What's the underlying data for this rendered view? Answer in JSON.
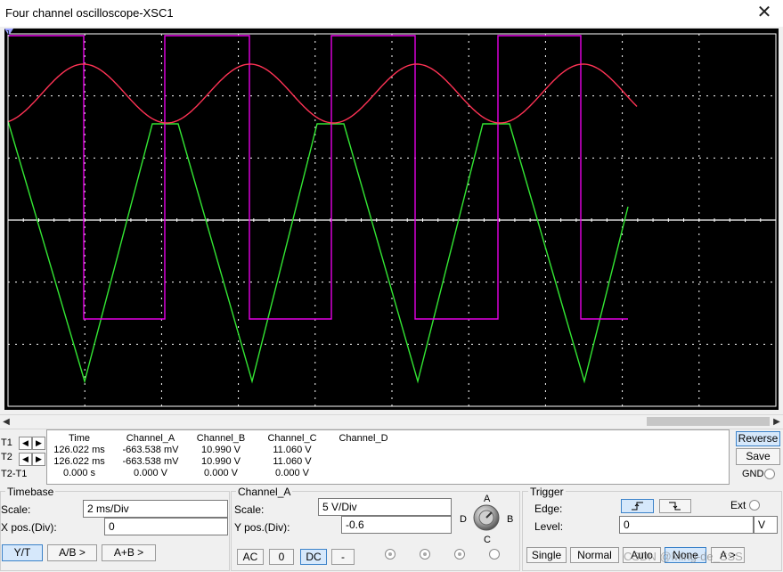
{
  "window": {
    "title": "Four channel oscilloscope-XSC1",
    "close_glyph": "✕"
  },
  "screen": {
    "background": "#000000",
    "grid_color": "#ffffff",
    "axis_color": "#ffffff",
    "channel_a_color": "#ff3355",
    "channel_b_color": "#33e633",
    "channel_c_color": "#e600e6",
    "cursor_color": "#ffffff",
    "cursor_t1_label": "1",
    "cursor_t2_label": "2"
  },
  "readout": {
    "row_labels": [
      "T1",
      "T2",
      "T2-T1"
    ],
    "headers": [
      "Time",
      "Channel_A",
      "Channel_B",
      "Channel_C",
      "Channel_D"
    ],
    "rows": [
      [
        "126.022 ms",
        "-663.538 mV",
        "10.990 V",
        "11.060 V",
        ""
      ],
      [
        "126.022 ms",
        "-663.538 mV",
        "10.990 V",
        "11.060 V",
        ""
      ],
      [
        "0.000 s",
        "0.000 V",
        "0.000 V",
        "0.000 V",
        ""
      ]
    ],
    "arrow_left": "◀",
    "arrow_right": "▶"
  },
  "side_buttons": {
    "reverse": "Reverse",
    "save": "Save",
    "gnd": "GND"
  },
  "timebase": {
    "title": "Timebase",
    "scale_label": "Scale:",
    "scale_value": "2 ms/Div",
    "xpos_label": "X pos.(Div):",
    "xpos_value": "0",
    "modes": [
      "Y/T",
      "A/B >",
      "A+B >"
    ]
  },
  "channel": {
    "title": "Channel_A",
    "scale_label": "Scale:",
    "scale_value": "5  V/Div",
    "ypos_label": "Y pos.(Div):",
    "ypos_value": "-0.6",
    "coupling": [
      "AC",
      "0",
      "DC",
      "-"
    ],
    "knob_labels": {
      "a": "A",
      "b": "B",
      "c": "C",
      "d": "D"
    }
  },
  "trigger": {
    "title": "Trigger",
    "edge_label": "Edge:",
    "ext_label": "Ext",
    "level_label": "Level:",
    "level_value": "0",
    "level_unit": "V",
    "modes": [
      "Single",
      "Normal",
      "Auto",
      "None",
      "A >"
    ]
  },
  "watermark": "CSDN @Ming-de_SSS"
}
